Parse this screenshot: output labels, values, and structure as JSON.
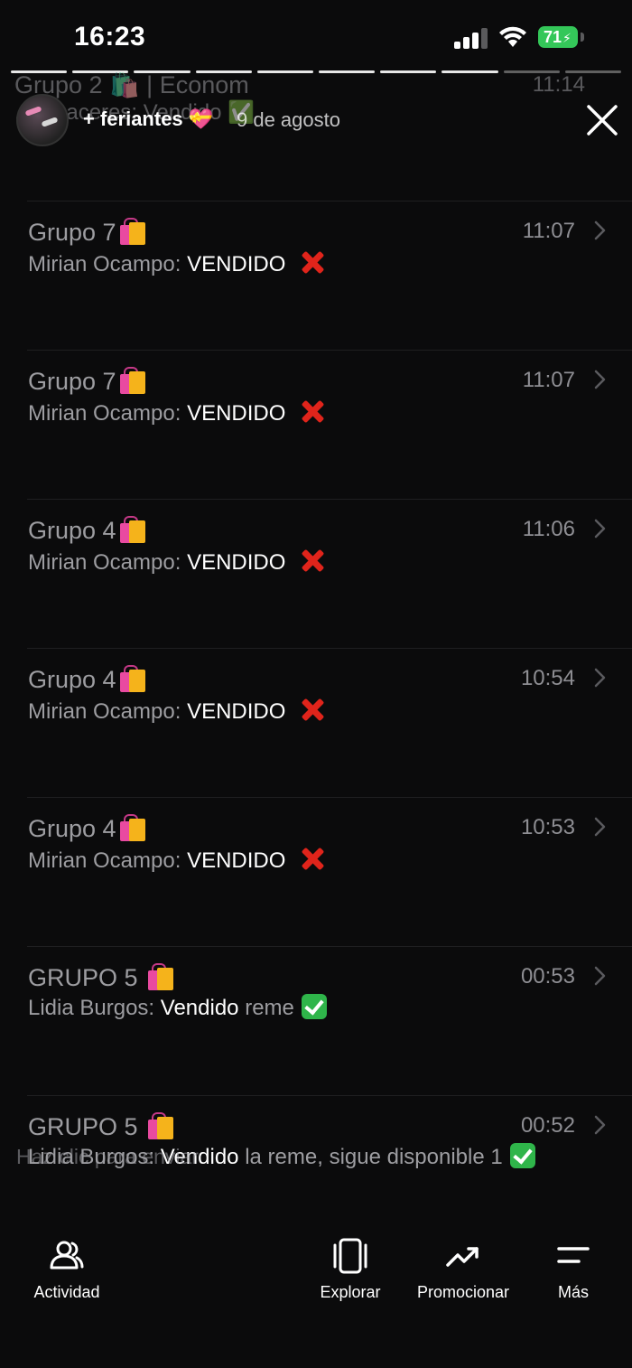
{
  "status_bar": {
    "time": "16:23",
    "battery": "71"
  },
  "ghost_row": {
    "title": "Grupo 2 🛍️ | Econom",
    "preview": "...h Caceres: Vendido ✅",
    "time": "11:14"
  },
  "story": {
    "name": "+ feriantes 💝",
    "date": "9 de agosto"
  },
  "chats": [
    {
      "title": "Grupo 7",
      "time": "11:07",
      "sender": "Mirian Ocampo:",
      "message": "VENDIDO",
      "rest": "",
      "mark": "x"
    },
    {
      "title": "Grupo 7",
      "time": "11:07",
      "sender": "Mirian Ocampo:",
      "message": "VENDIDO",
      "rest": "",
      "mark": "x"
    },
    {
      "title": "Grupo 4",
      "time": "11:06",
      "sender": "Mirian Ocampo:",
      "message": "VENDIDO",
      "rest": "",
      "mark": "x"
    },
    {
      "title": "Grupo 4",
      "time": "10:54",
      "sender": "Mirian Ocampo:",
      "message": "VENDIDO",
      "rest": "",
      "mark": "x"
    },
    {
      "title": "Grupo 4",
      "time": "10:53",
      "sender": "Mirian Ocampo:",
      "message": "VENDIDO",
      "rest": "",
      "mark": "x"
    },
    {
      "title": "GRUPO 5 ",
      "time": "00:53",
      "sender": "Lidia Burgos:",
      "message": "Vendido",
      "rest": "reme",
      "mark": "check"
    },
    {
      "title": "GRUPO 5 ",
      "time": "00:52",
      "sender": "Lidia Burgos:",
      "message": "Vendido",
      "rest": "la reme, sigue disponible 1",
      "mark": "check"
    }
  ],
  "overlay_caption": "Haz clic para enviar",
  "bottom_nav": {
    "activity": "Actividad",
    "explore": "Explorar",
    "promote": "Promocionar",
    "more": "Más"
  }
}
